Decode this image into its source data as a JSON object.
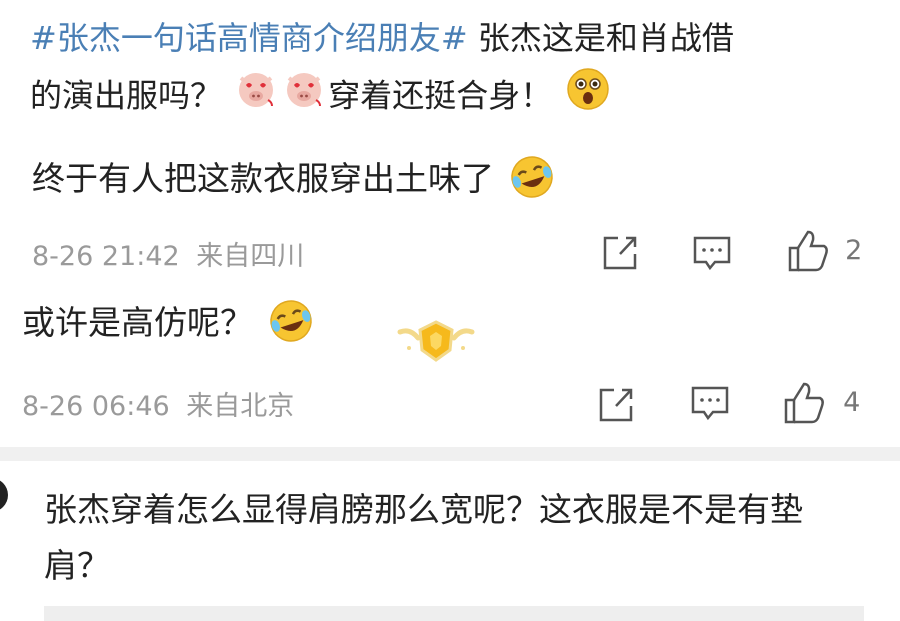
{
  "post": {
    "topic": "#张杰一句话高情商介绍朋友#",
    "line1_rest": " 张杰这是和肖战借",
    "line2_before": "的演出服吗？",
    "line2_after": "穿着还挺合身！",
    "emojis": [
      "pig-heart-eyes-icon",
      "pig-heart-eyes-icon",
      "surprised-face-icon"
    ]
  },
  "comments": [
    {
      "text": "终于有人把这款衣服穿出土味了",
      "emoji": "laugh-cry-icon",
      "time": "8-26 21:42",
      "source": "来自四川",
      "likes": "2"
    },
    {
      "text": "或许是高仿呢？",
      "emoji": "laugh-cry-icon",
      "badge": "gold-badge-icon",
      "time": "8-26 06:46",
      "source": "来自北京",
      "likes": "4"
    }
  ],
  "reply": {
    "text": "张杰穿着怎么显得肩膀那么宽呢？这衣服是不是有垫肩？"
  },
  "colors": {
    "topic": "#4a7fb5",
    "meta": "#9a9a9a",
    "divider": "#f0f0f0"
  }
}
